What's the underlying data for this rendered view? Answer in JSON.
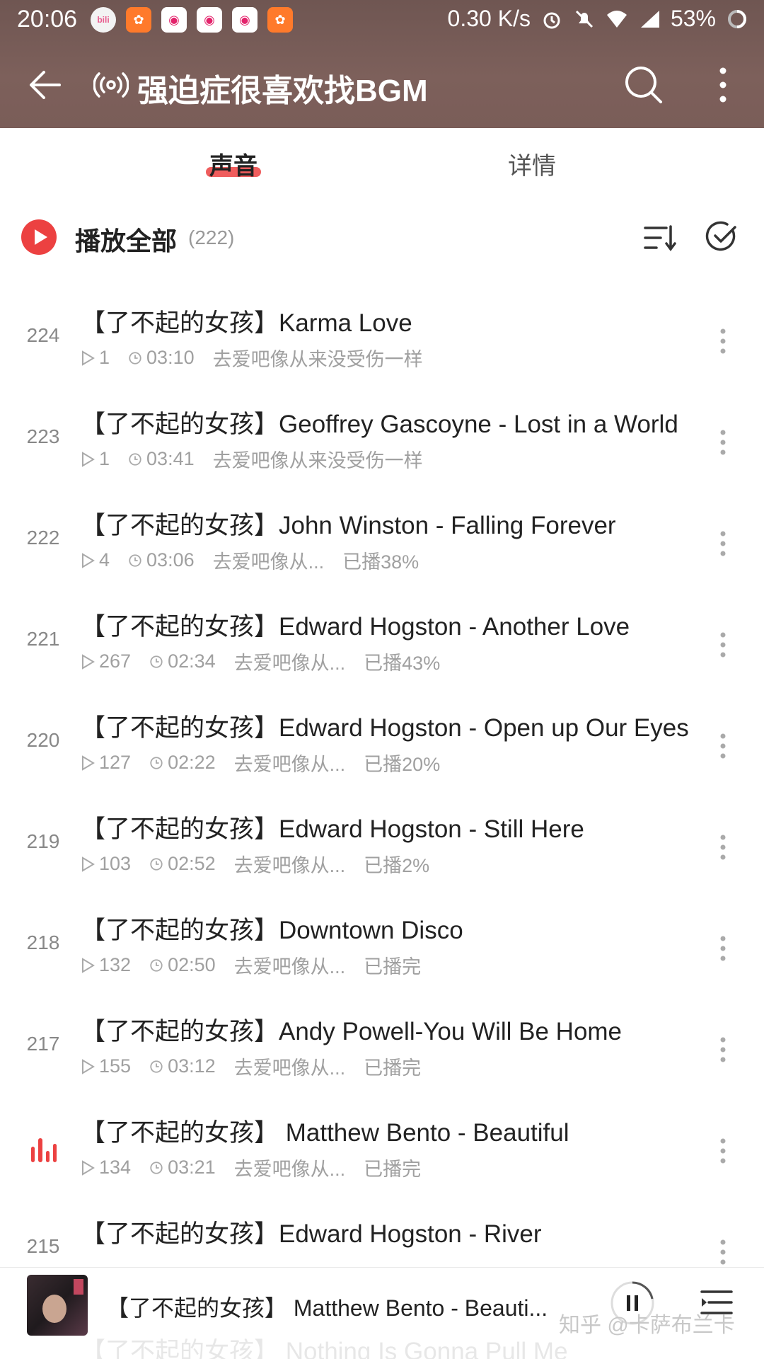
{
  "status_bar": {
    "time": "20:06",
    "network_speed": "0.30 K/s",
    "battery": "53%"
  },
  "header": {
    "title": "强迫症很喜欢找BGM"
  },
  "tabs": [
    {
      "label": "声音",
      "active": true
    },
    {
      "label": "详情",
      "active": false
    }
  ],
  "play_all": {
    "label": "播放全部",
    "count": "(222)"
  },
  "tracks": [
    {
      "index": "224",
      "title": "【了不起的女孩】Karma Love",
      "plays": "1",
      "duration": "03:10",
      "author": "去爱吧像从来没受伤一样",
      "progress": ""
    },
    {
      "index": "223",
      "title": "【了不起的女孩】Geoffrey Gascoyne - Lost in a World",
      "plays": "1",
      "duration": "03:41",
      "author": "去爱吧像从来没受伤一样",
      "progress": ""
    },
    {
      "index": "222",
      "title": "【了不起的女孩】John Winston - Falling Forever",
      "plays": "4",
      "duration": "03:06",
      "author": "去爱吧像从...",
      "progress": "已播38%"
    },
    {
      "index": "221",
      "title": "【了不起的女孩】Edward Hogston - Another Love",
      "plays": "267",
      "duration": "02:34",
      "author": "去爱吧像从...",
      "progress": "已播43%"
    },
    {
      "index": "220",
      "title": "【了不起的女孩】Edward Hogston - Open up Our Eyes",
      "plays": "127",
      "duration": "02:22",
      "author": "去爱吧像从...",
      "progress": "已播20%"
    },
    {
      "index": "219",
      "title": "【了不起的女孩】Edward Hogston - Still Here",
      "plays": "103",
      "duration": "02:52",
      "author": "去爱吧像从...",
      "progress": "已播2%"
    },
    {
      "index": "218",
      "title": "【了不起的女孩】Downtown Disco",
      "plays": "132",
      "duration": "02:50",
      "author": "去爱吧像从...",
      "progress": "已播完"
    },
    {
      "index": "217",
      "title": "【了不起的女孩】Andy Powell-You Will Be Home",
      "plays": "155",
      "duration": "03:12",
      "author": "去爱吧像从...",
      "progress": "已播完"
    },
    {
      "index": "",
      "playing": true,
      "title": "【了不起的女孩】 Matthew Bento - Beautiful",
      "plays": "134",
      "duration": "03:21",
      "author": "去爱吧像从...",
      "progress": "已播完"
    },
    {
      "index": "215",
      "title": "【了不起的女孩】Edward Hogston - River",
      "plays": "",
      "duration": "",
      "author": "",
      "progress": ""
    }
  ],
  "mini_player": {
    "title": "【了不起的女孩】 Matthew Bento - Beauti...",
    "next_peek": "【了不起的女孩】 Nothing Is Gonna Pull Me",
    "watermark": "知乎 @卡萨布兰卡"
  },
  "colors": {
    "accent": "#ec4141",
    "header_bg": "#7a5d58"
  }
}
